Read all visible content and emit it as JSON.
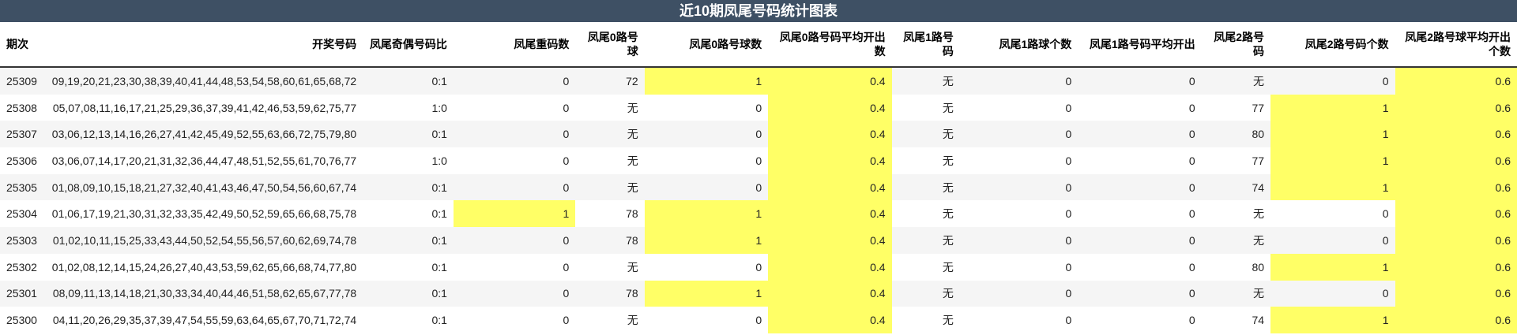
{
  "title": "近10期凤尾号码统计图表",
  "columns": [
    "期次",
    "开奖号码",
    "凤尾奇偶号码比",
    "凤尾重码数",
    "凤尾0路号球",
    "凤尾0路号球数",
    "凤尾0路号码平均开出数",
    "凤尾1路号码",
    "凤尾1路球个数",
    "凤尾1路号码平均开出",
    "凤尾2路号码",
    "凤尾2路号码个数",
    "凤尾2路号球平均开出个数"
  ],
  "highlight_color": "#ffff66",
  "rows": [
    {
      "cells": [
        "25309",
        "09,19,20,21,23,30,38,39,40,41,44,48,53,54,58,60,61,65,68,72",
        "0:1",
        "0",
        "72",
        "1",
        "0.4",
        "无",
        "0",
        "0",
        "无",
        "0",
        "0.6"
      ],
      "hl": [
        5,
        6,
        12
      ]
    },
    {
      "cells": [
        "25308",
        "05,07,08,11,16,17,21,25,29,36,37,39,41,42,46,53,59,62,75,77",
        "1:0",
        "0",
        "无",
        "0",
        "0.4",
        "无",
        "0",
        "0",
        "77",
        "1",
        "0.6"
      ],
      "hl": [
        6,
        11,
        12
      ]
    },
    {
      "cells": [
        "25307",
        "03,06,12,13,14,16,26,27,41,42,45,49,52,55,63,66,72,75,79,80",
        "0:1",
        "0",
        "无",
        "0",
        "0.4",
        "无",
        "0",
        "0",
        "80",
        "1",
        "0.6"
      ],
      "hl": [
        6,
        11,
        12
      ]
    },
    {
      "cells": [
        "25306",
        "03,06,07,14,17,20,21,31,32,36,44,47,48,51,52,55,61,70,76,77",
        "1:0",
        "0",
        "无",
        "0",
        "0.4",
        "无",
        "0",
        "0",
        "77",
        "1",
        "0.6"
      ],
      "hl": [
        6,
        11,
        12
      ]
    },
    {
      "cells": [
        "25305",
        "01,08,09,10,15,18,21,27,32,40,41,43,46,47,50,54,56,60,67,74",
        "0:1",
        "0",
        "无",
        "0",
        "0.4",
        "无",
        "0",
        "0",
        "74",
        "1",
        "0.6"
      ],
      "hl": [
        6,
        11,
        12
      ]
    },
    {
      "cells": [
        "25304",
        "01,06,17,19,21,30,31,32,33,35,42,49,50,52,59,65,66,68,75,78",
        "0:1",
        "1",
        "78",
        "1",
        "0.4",
        "无",
        "0",
        "0",
        "无",
        "0",
        "0.6"
      ],
      "hl": [
        3,
        5,
        6,
        12
      ]
    },
    {
      "cells": [
        "25303",
        "01,02,10,11,15,25,33,43,44,50,52,54,55,56,57,60,62,69,74,78",
        "0:1",
        "0",
        "78",
        "1",
        "0.4",
        "无",
        "0",
        "0",
        "无",
        "0",
        "0.6"
      ],
      "hl": [
        5,
        6,
        12
      ]
    },
    {
      "cells": [
        "25302",
        "01,02,08,12,14,15,24,26,27,40,43,53,59,62,65,66,68,74,77,80",
        "0:1",
        "0",
        "无",
        "0",
        "0.4",
        "无",
        "0",
        "0",
        "80",
        "1",
        "0.6"
      ],
      "hl": [
        6,
        11,
        12
      ]
    },
    {
      "cells": [
        "25301",
        "08,09,11,13,14,18,21,30,33,34,40,44,46,51,58,62,65,67,77,78",
        "0:1",
        "0",
        "78",
        "1",
        "0.4",
        "无",
        "0",
        "0",
        "无",
        "0",
        "0.6"
      ],
      "hl": [
        5,
        6,
        12
      ]
    },
    {
      "cells": [
        "25300",
        "04,11,20,26,29,35,37,39,47,54,55,59,63,64,65,67,70,71,72,74",
        "0:1",
        "0",
        "无",
        "0",
        "0.4",
        "无",
        "0",
        "0",
        "74",
        "1",
        "0.6"
      ],
      "hl": [
        6,
        11,
        12
      ]
    }
  ]
}
